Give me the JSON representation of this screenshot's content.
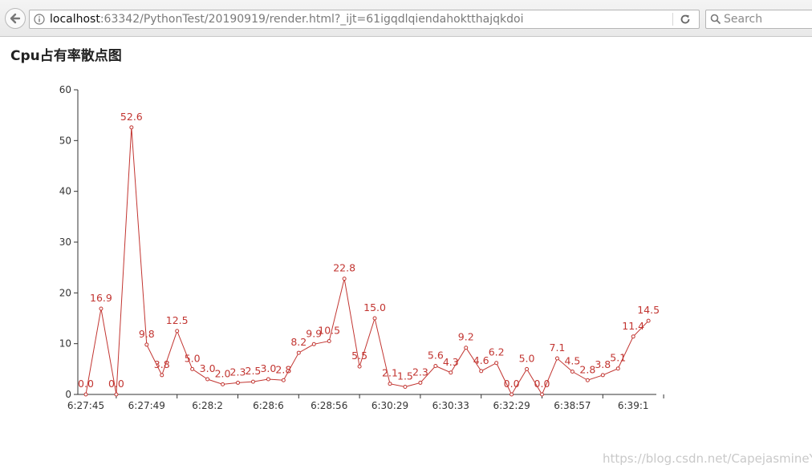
{
  "browser": {
    "url_host": "localhost",
    "url_rest": ":63342/PythonTest/20190919/render.html?_ijt=61igqdlqiendahoktthajqkdoi",
    "search_placeholder": "Search"
  },
  "page": {
    "title": "Cpu占有率散点图"
  },
  "watermark": "https://blog.csdn.net/CapejasmineY",
  "chart_data": {
    "type": "line",
    "title": "",
    "xlabel": "",
    "ylabel": "",
    "ylim": [
      0,
      60
    ],
    "yticks": [
      0,
      10,
      20,
      30,
      40,
      50,
      60
    ],
    "grid": false,
    "legend": "none",
    "color": "#c23531",
    "point_labels": true,
    "x": [
      "6:27:45",
      "",
      "",
      "",
      "6:27:49",
      "",
      "",
      "",
      "6:28:2",
      "",
      "",
      "",
      "6:28:6",
      "",
      "",
      "",
      "6:28:56",
      "",
      "",
      "",
      "6:30:29",
      "",
      "",
      "",
      "6:30:33",
      "",
      "",
      "",
      "6:32:29",
      "",
      "",
      "",
      "6:38:57",
      "",
      "",
      "",
      "6:39:1",
      "",
      ""
    ],
    "xtick_labels": [
      "6:27:45",
      "6:27:49",
      "6:28:2",
      "6:28:6",
      "6:28:56",
      "6:30:29",
      "6:30:33",
      "6:32:29",
      "6:38:57",
      "6:39:1"
    ],
    "series": [
      {
        "values": [
          0.0,
          16.9,
          0.0,
          52.6,
          9.8,
          3.8,
          12.5,
          5.0,
          3.0,
          2.0,
          2.3,
          2.5,
          3.0,
          2.8,
          8.2,
          9.9,
          10.5,
          22.8,
          5.5,
          15.0,
          2.1,
          1.5,
          2.3,
          5.6,
          4.3,
          9.2,
          4.6,
          6.2,
          0.0,
          5.0,
          0.0,
          7.1,
          4.5,
          2.8,
          3.8,
          5.1,
          11.4,
          14.5
        ],
        "labels": [
          "0.0",
          "16.9",
          "0.0",
          "52.6",
          "9.8",
          "3.8",
          "12.5",
          "5.0",
          "3.0",
          "2.0",
          "2.3",
          "2.5",
          "3.0",
          "2.8",
          "8.2",
          "9.9",
          "10.5",
          "22.8",
          "5.5",
          "15.0",
          "2.1",
          "1.5",
          "2.3",
          "5.6",
          "4.3",
          "9.2",
          "4.6",
          "6.2",
          "0.0",
          "5.0",
          "0.0",
          "7.1",
          "4.5",
          "2.8",
          "3.8",
          "5.1",
          "11.4",
          "14.5"
        ]
      }
    ]
  }
}
